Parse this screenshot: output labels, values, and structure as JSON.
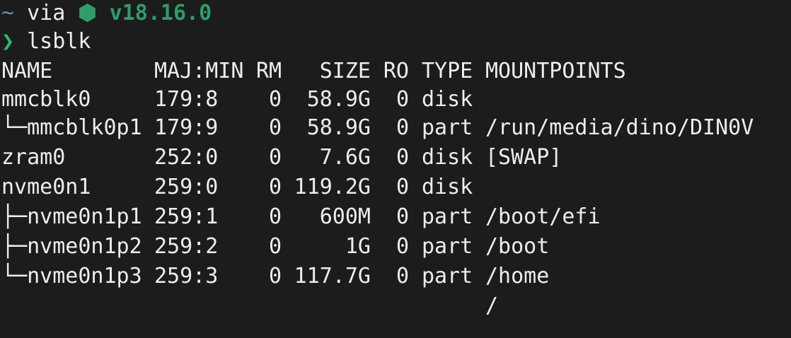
{
  "prompt": {
    "dir": "~",
    "via": "via",
    "node_icon": "⬢",
    "node_version": "v18.16.0",
    "symbol": "❯",
    "command": "lsblk"
  },
  "table": {
    "headers": {
      "name": "NAME",
      "majmin": "MAJ:MIN",
      "rm": "RM",
      "size": "SIZE",
      "ro": "RO",
      "type": "TYPE",
      "mount": "MOUNTPOINTS"
    },
    "rows": [
      {
        "tree": "",
        "name": "mmcblk0",
        "majmin": "179:8",
        "rm": "0",
        "size": "58.9G",
        "ro": "0",
        "type": "disk",
        "mount": ""
      },
      {
        "tree": "└─",
        "name": "mmcblk0p1",
        "majmin": "179:9",
        "rm": "0",
        "size": "58.9G",
        "ro": "0",
        "type": "part",
        "mount": "/run/media/dino/DIN0V"
      },
      {
        "tree": "",
        "name": "zram0",
        "majmin": "252:0",
        "rm": "0",
        "size": "7.6G",
        "ro": "0",
        "type": "disk",
        "mount": "[SWAP]"
      },
      {
        "tree": "",
        "name": "nvme0n1",
        "majmin": "259:0",
        "rm": "0",
        "size": "119.2G",
        "ro": "0",
        "type": "disk",
        "mount": ""
      },
      {
        "tree": "├─",
        "name": "nvme0n1p1",
        "majmin": "259:1",
        "rm": "0",
        "size": "600M",
        "ro": "0",
        "type": "part",
        "mount": "/boot/efi"
      },
      {
        "tree": "├─",
        "name": "nvme0n1p2",
        "majmin": "259:2",
        "rm": "0",
        "size": "1G",
        "ro": "0",
        "type": "part",
        "mount": "/boot"
      },
      {
        "tree": "└─",
        "name": "nvme0n1p3",
        "majmin": "259:3",
        "rm": "0",
        "size": "117.7G",
        "ro": "0",
        "type": "part",
        "mount": "/home"
      },
      {
        "tree": "",
        "name": "",
        "majmin": "",
        "rm": "",
        "size": "",
        "ro": "",
        "type": "",
        "mount": "/"
      }
    ]
  },
  "colors": {
    "background": "#1c1c1c",
    "foreground": "#ededed",
    "node_green": "#2e9d6a",
    "prompt_green": "#2eb86f",
    "tilde_blue": "#5f8fa6"
  }
}
